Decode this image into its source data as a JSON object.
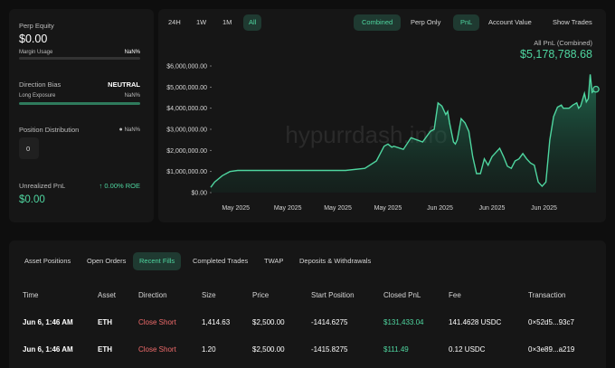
{
  "left": {
    "perp_equity_label": "Perp Equity",
    "perp_equity_value": "$0.00",
    "margin_usage_label": "Margin Usage",
    "margin_usage_value": "NaN%",
    "margin_usage_fraction": 0.0,
    "direction_bias_label": "Direction Bias",
    "direction_bias_value": "NEUTRAL",
    "long_exposure_label": "Long Exposure",
    "long_exposure_value": "NaN%",
    "long_exposure_fraction": 0.0,
    "position_distribution_label": "Position Distribution",
    "position_distribution_value": "NaN%",
    "position_count": "0",
    "unrealized_pnl_label": "Unrealized PnL",
    "roe_value": "0.00% ROE",
    "unrealized_pnl_value": "$0.00"
  },
  "toolbar": {
    "ranges": [
      "24H",
      "1W",
      "1M",
      "All"
    ],
    "active_range": "All",
    "scope": [
      "Combined",
      "Perp Only"
    ],
    "metric": [
      "PnL",
      "Account Value"
    ],
    "show_trades": "Show Trades"
  },
  "pnl": {
    "title": "All PnL (Combined)",
    "value": "$5,178,788.68"
  },
  "watermark": "hypurrdash.info",
  "colors": {
    "accent": "#4fd6a0",
    "negative": "#f06b6b",
    "panel": "#161616",
    "background": "#0e0e0e"
  },
  "chart_data": {
    "type": "area",
    "title": "",
    "xlabel": "",
    "ylabel": "",
    "ylim": [
      0,
      6000000
    ],
    "y_ticks": [
      0,
      1000000,
      2000000,
      3000000,
      4000000,
      5000000,
      6000000
    ],
    "y_tick_labels": [
      "$0.00",
      "$1,000,000.00",
      "$2,000,000.00",
      "$3,000,000.00",
      "$4,000,000.00",
      "$5,000,000.00",
      "$6,000,000.00"
    ],
    "x_tick_labels": [
      "May 2025",
      "May 2025",
      "May 2025",
      "May 2025",
      "Jun 2025",
      "Jun 2025",
      "Jun 2025"
    ],
    "x_range": [
      0,
      100
    ],
    "x_ticks": [
      6.5,
      20,
      33,
      46,
      59.5,
      73,
      86.5
    ],
    "grid": false,
    "series": [
      {
        "name": "",
        "x": [
          0,
          1,
          3,
          5,
          7,
          9,
          12,
          15,
          20,
          25,
          30,
          35,
          40,
          43,
          45,
          46,
          47,
          47.5,
          50,
          52,
          55,
          57,
          58,
          59,
          60,
          61,
          61.5,
          62,
          63,
          63.5,
          64,
          65,
          66,
          67,
          68,
          69,
          70,
          71,
          72,
          73,
          74,
          75,
          76,
          77,
          78,
          79,
          80,
          81,
          82,
          83,
          84,
          85,
          86,
          87,
          88,
          89,
          90,
          91,
          91.5,
          92,
          93,
          94,
          95,
          95.5,
          96,
          97,
          97.5,
          98,
          98.5,
          99,
          100
        ],
        "y": [
          250000,
          500000,
          800000,
          1000000,
          1050000,
          1050000,
          1050000,
          1050000,
          1050000,
          1050000,
          1050000,
          1050000,
          1150000,
          1500000,
          2200000,
          2300000,
          2150000,
          2200000,
          2050000,
          2600000,
          2400000,
          2900000,
          3000000,
          4250000,
          4100000,
          3700000,
          3850000,
          3300000,
          2400000,
          2300000,
          2500000,
          3500000,
          3300000,
          2900000,
          1700000,
          900000,
          900000,
          1600000,
          1300000,
          1700000,
          1900000,
          2100000,
          1700000,
          1250000,
          1150000,
          1500000,
          1600000,
          1850000,
          1600000,
          1400000,
          1300000,
          500000,
          300000,
          500000,
          2500000,
          3600000,
          4050000,
          4150000,
          4000000,
          4000000,
          4000000,
          4150000,
          4250000,
          4000000,
          4100000,
          4700000,
          4300000,
          4450000,
          5600000,
          4750000,
          4900000
        ]
      }
    ]
  },
  "tabs": [
    "Asset Positions",
    "Open Orders",
    "Recent Fills",
    "Completed Trades",
    "TWAP",
    "Deposits & Withdrawals"
  ],
  "active_tab": "Recent Fills",
  "table": {
    "headers": [
      "Time",
      "Asset",
      "Direction",
      "Size",
      "Price",
      "Start Position",
      "Closed PnL",
      "Fee",
      "Transaction"
    ],
    "rows": [
      [
        "Jun 6, 1:46 AM",
        "ETH",
        "Close Short",
        "1,414.63",
        "$2,500.00",
        "-1414.6275",
        "$131,433.04",
        "141.4628 USDC",
        "0×52d5...93c7"
      ],
      [
        "Jun 6, 1:46 AM",
        "ETH",
        "Close Short",
        "1.20",
        "$2,500.00",
        "-1415.8275",
        "$111.49",
        "0.12 USDC",
        "0×3e89...a219"
      ]
    ]
  }
}
